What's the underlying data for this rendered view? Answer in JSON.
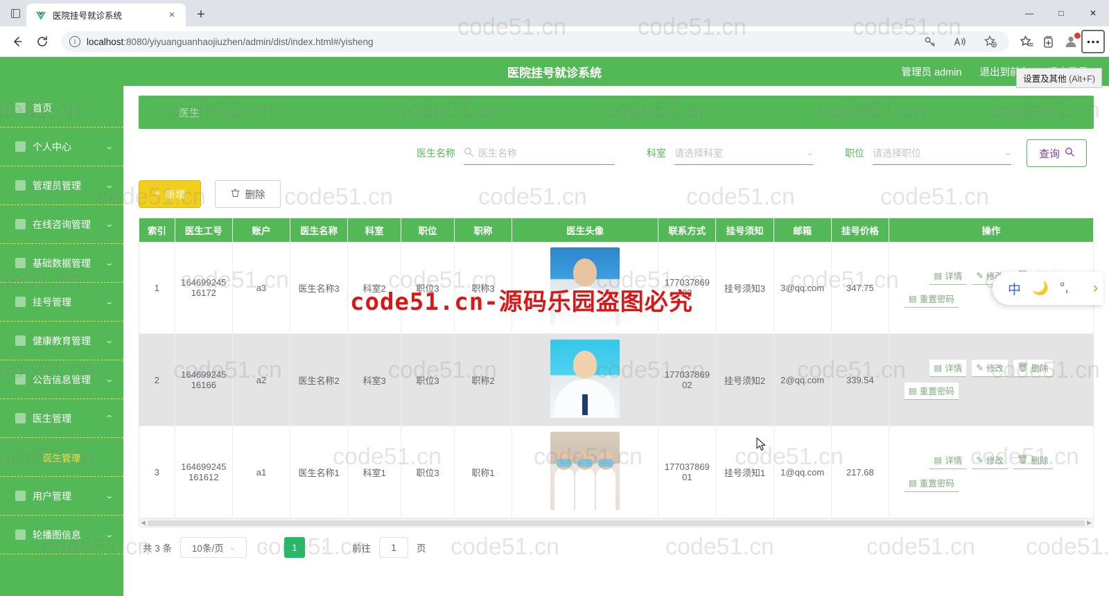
{
  "browser": {
    "tab": {
      "title": "医院挂号就诊系统",
      "favicon": "vue-logo-icon",
      "close": "×"
    },
    "new_tab": "+",
    "window_controls": {
      "minimize": "—",
      "maximize": "□",
      "close": "✕"
    },
    "url_prefix": "localhost",
    "url_rest": ":8080/yiyuanguanhaojiuzhen/admin/dist/index.html#/yisheng",
    "tooltip": "设置及其他",
    "tooltip_key": "(Alt+F)"
  },
  "watermark": {
    "text": "code51.cn",
    "red_text": "code51.cn-源码乐园盗图必究"
  },
  "header": {
    "title": "医院挂号就诊系统",
    "user": "管理员 admin",
    "exit_front": "退出到前台",
    "logout": "退出登录"
  },
  "sidebar": {
    "items": [
      {
        "label": "首页",
        "icon": "home-icon",
        "arrow": "",
        "active": false
      },
      {
        "label": "个人中心",
        "icon": "user-icon",
        "arrow": "⌄",
        "active": false
      },
      {
        "label": "管理员管理",
        "icon": "admin-icon",
        "arrow": "⌄",
        "active": false
      },
      {
        "label": "在线咨询管理",
        "icon": "chat-icon",
        "arrow": "⌄",
        "active": false
      },
      {
        "label": "基础数据管理",
        "icon": "database-icon",
        "arrow": "⌄",
        "active": false
      },
      {
        "label": "挂号管理",
        "icon": "ticket-icon",
        "arrow": "⌄",
        "active": false
      },
      {
        "label": "健康教育管理",
        "icon": "book-icon",
        "arrow": "⌄",
        "active": false
      },
      {
        "label": "公告信息管理",
        "icon": "bell-icon",
        "arrow": "⌄",
        "active": false
      },
      {
        "label": "医生管理",
        "icon": "doctor-icon",
        "arrow": "⌃",
        "active": true
      }
    ],
    "submenu": {
      "label": "医生管理"
    },
    "items_after": [
      {
        "label": "用户管理",
        "icon": "users-icon",
        "arrow": "⌄"
      },
      {
        "label": "轮播图信息",
        "icon": "image-icon",
        "arrow": "⌄"
      }
    ]
  },
  "banner": {
    "label": "医生"
  },
  "search": {
    "name_label": "医生名称",
    "name_placeholder": "医生名称",
    "name_value": "",
    "dept_label": "科室",
    "dept_placeholder": "请选择科室",
    "dept_value": "",
    "pos_label": "职位",
    "pos_placeholder": "请选择职位",
    "pos_value": "",
    "query_button": "查询"
  },
  "toolbar": {
    "add_label": "新增",
    "add_icon": "plus-icon",
    "delete_label": "删除",
    "delete_icon": "trash-icon"
  },
  "table": {
    "columns": [
      "索引",
      "医生工号",
      "账户",
      "医生名称",
      "科室",
      "职位",
      "职称",
      "医生头像",
      "联系方式",
      "挂号须知",
      "邮箱",
      "挂号价格",
      "操作"
    ],
    "rows": [
      {
        "index": "1",
        "work_id": "16469924516172",
        "account": "a3",
        "name": "医生名称3",
        "dept": "科室2",
        "position": "职位3",
        "title": "职称3",
        "avatar": "doctor-portrait-1",
        "phone": "17703786903",
        "notice": "挂号须知3",
        "email": "3@qq.com",
        "price": "347.75"
      },
      {
        "index": "2",
        "work_id": "16469924516166",
        "account": "a2",
        "name": "医生名称2",
        "dept": "科室3",
        "position": "职位3",
        "title": "职称2",
        "avatar": "doctor-portrait-2",
        "phone": "17703786902",
        "notice": "挂号须知2",
        "email": "2@qq.com",
        "price": "339.54"
      },
      {
        "index": "3",
        "work_id": "164699245161612",
        "account": "a1",
        "name": "医生名称1",
        "dept": "科室1",
        "position": "职位3",
        "title": "职称1",
        "avatar": "doctor-group-photo",
        "phone": "17703786901",
        "notice": "挂号须知1",
        "email": "1@qq.com",
        "price": "217.68"
      }
    ],
    "actions": {
      "detail": "详情",
      "edit": "修改",
      "delete": "删除",
      "reset_pwd": "重置密码"
    }
  },
  "pagination": {
    "total": "共 3 条",
    "page_size": "10条/页",
    "prev": "‹",
    "current": "1",
    "next": "›",
    "goto_label": "前往",
    "goto_value": "1",
    "page_unit": "页"
  },
  "ime": {
    "mode": "中",
    "moon": "moon-icon",
    "punct": "punctuation-icon",
    "arrow": "›"
  },
  "colors": {
    "primary_green": "#53b957",
    "add_yellow": "#f2cf1f",
    "page_active": "#22bb66",
    "watermark_red": "#d81717"
  }
}
